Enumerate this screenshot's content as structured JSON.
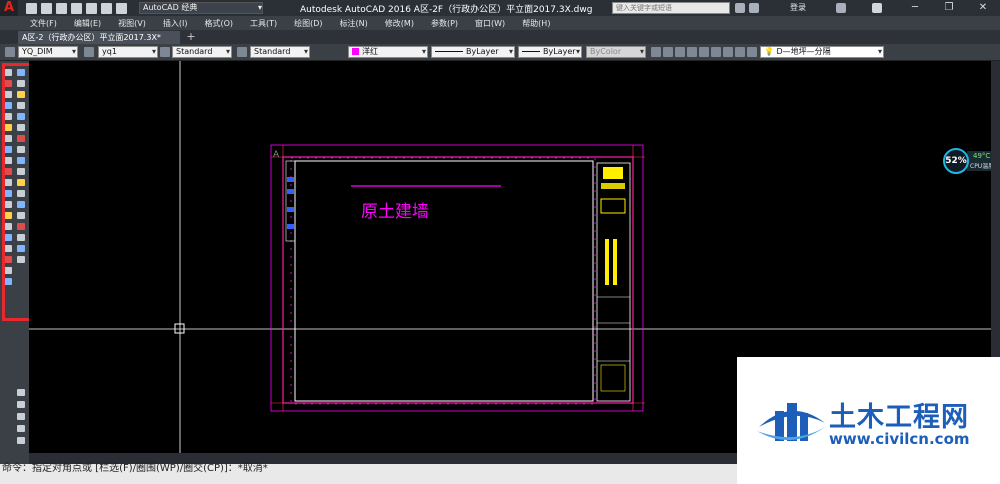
{
  "app": {
    "logo_letter": "A",
    "workspace": "AutoCAD 经典",
    "title": "Autodesk AutoCAD 2016    A区-2F（行政办公区）平立面2017.3X.dwg",
    "search_placeholder": "键入关键字或短语",
    "login_label": "登录"
  },
  "menu": [
    "文件(F)",
    "编辑(E)",
    "视图(V)",
    "插入(I)",
    "格式(O)",
    "工具(T)",
    "绘图(D)",
    "标注(N)",
    "修改(M)",
    "参数(P)",
    "窗口(W)",
    "帮助(H)"
  ],
  "tabs": [
    {
      "label": "A区-2（行政办公区）平立面2017.3X*"
    }
  ],
  "tab_add": "+",
  "properties": {
    "text_style": "YQ_DIM",
    "dim_style": "yq1",
    "table_style": "Standard",
    "multileader_style": "Standard",
    "color": "洋红",
    "linetype": "ByLayer",
    "lineweight": "ByLayer",
    "plotstyle": "ByColor",
    "layer": "D—地坪—分隔",
    "color_hex": "#ff00ff"
  },
  "drawing": {
    "note_text": "原土建墙",
    "corner_label": "A",
    "magenta": "#ff00ff",
    "titleblock_yellow": "#ffee00"
  },
  "cpu": {
    "usage": "52%",
    "temperature": "49°C",
    "label": "CPU温度"
  },
  "command_line": "命令：指定对角点或 [栏选(F)/圈围(WP)/圈交(CP)]：*取消*",
  "watermark": {
    "title": "土木工程网",
    "url": "www.civilcn.com"
  }
}
